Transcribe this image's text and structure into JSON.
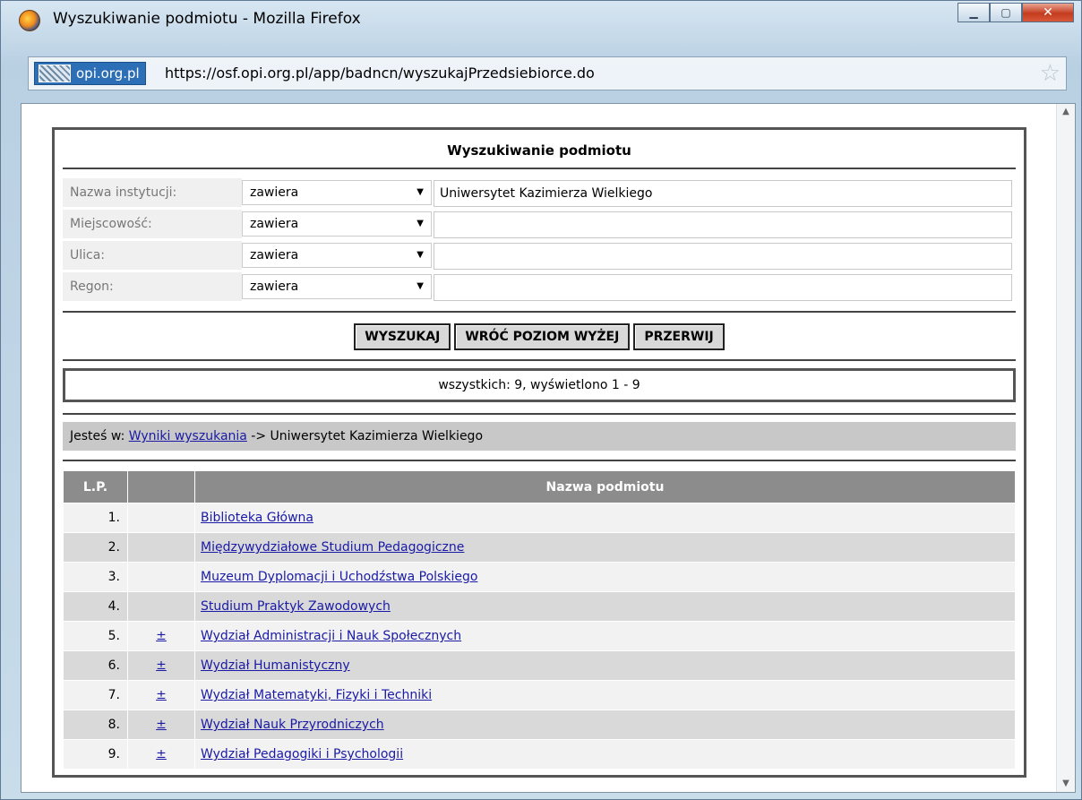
{
  "window": {
    "title": "Wyszukiwanie podmiotu - Mozilla Firefox",
    "site_id": "opi.org.pl",
    "url": "https://osf.opi.org.pl/app/badncn/wyszukajPrzedsiebiorce.do"
  },
  "page": {
    "heading": "Wyszukiwanie podmiotu",
    "form": {
      "rows": [
        {
          "label": "Nazwa instytucji:",
          "operator": "zawiera",
          "value": "Uniwersytet Kazimierza Wielkiego"
        },
        {
          "label": "Miejscowość:",
          "operator": "zawiera",
          "value": ""
        },
        {
          "label": "Ulica:",
          "operator": "zawiera",
          "value": ""
        },
        {
          "label": "Regon:",
          "operator": "zawiera",
          "value": ""
        }
      ]
    },
    "buttons": {
      "search": "WYSZUKAJ",
      "up": "WRÓĆ POZIOM WYŻEJ",
      "abort": "PRZERWIJ"
    },
    "count_text": "wszystkich: 9, wyświetlono 1 - 9",
    "breadcrumb": {
      "prefix": "Jesteś w: ",
      "link": "Wyniki wyszukania",
      "suffix": " -> Uniwersytet Kazimierza Wielkiego"
    },
    "table": {
      "headers": {
        "lp": "L.P.",
        "expand": "",
        "name": "Nazwa podmiotu"
      },
      "rows": [
        {
          "lp": "1.",
          "expand": "",
          "name": "Biblioteka Główna"
        },
        {
          "lp": "2.",
          "expand": "",
          "name": "Międzywydziałowe Studium Pedagogiczne"
        },
        {
          "lp": "3.",
          "expand": "",
          "name": "Muzeum Dyplomacji i Uchodźstwa Polskiego"
        },
        {
          "lp": "4.",
          "expand": "",
          "name": "Studium Praktyk Zawodowych"
        },
        {
          "lp": "5.",
          "expand": "±",
          "name": "Wydział Administracji i Nauk Społecznych"
        },
        {
          "lp": "6.",
          "expand": "±",
          "name": "Wydział Humanistyczny"
        },
        {
          "lp": "7.",
          "expand": "±",
          "name": "Wydział Matematyki, Fizyki i Techniki"
        },
        {
          "lp": "8.",
          "expand": "±",
          "name": "Wydział Nauk Przyrodniczych"
        },
        {
          "lp": "9.",
          "expand": "±",
          "name": "Wydział Pedagogiki i Psychologii"
        }
      ]
    }
  }
}
